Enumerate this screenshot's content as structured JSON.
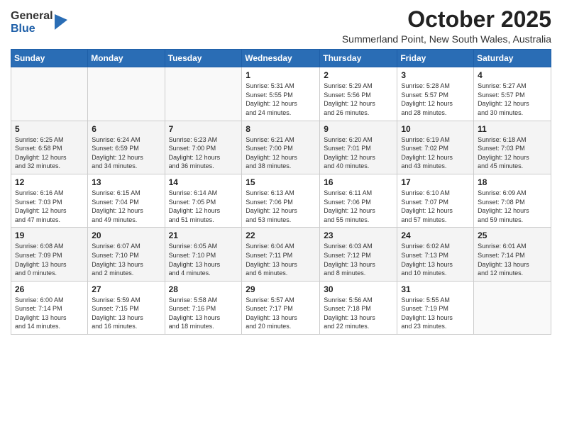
{
  "header": {
    "logo_general": "General",
    "logo_blue": "Blue",
    "month": "October 2025",
    "location": "Summerland Point, New South Wales, Australia"
  },
  "weekdays": [
    "Sunday",
    "Monday",
    "Tuesday",
    "Wednesday",
    "Thursday",
    "Friday",
    "Saturday"
  ],
  "weeks": [
    [
      {
        "day": "",
        "info": ""
      },
      {
        "day": "",
        "info": ""
      },
      {
        "day": "",
        "info": ""
      },
      {
        "day": "1",
        "info": "Sunrise: 5:31 AM\nSunset: 5:55 PM\nDaylight: 12 hours\nand 24 minutes."
      },
      {
        "day": "2",
        "info": "Sunrise: 5:29 AM\nSunset: 5:56 PM\nDaylight: 12 hours\nand 26 minutes."
      },
      {
        "day": "3",
        "info": "Sunrise: 5:28 AM\nSunset: 5:57 PM\nDaylight: 12 hours\nand 28 minutes."
      },
      {
        "day": "4",
        "info": "Sunrise: 5:27 AM\nSunset: 5:57 PM\nDaylight: 12 hours\nand 30 minutes."
      }
    ],
    [
      {
        "day": "5",
        "info": "Sunrise: 6:25 AM\nSunset: 6:58 PM\nDaylight: 12 hours\nand 32 minutes."
      },
      {
        "day": "6",
        "info": "Sunrise: 6:24 AM\nSunset: 6:59 PM\nDaylight: 12 hours\nand 34 minutes."
      },
      {
        "day": "7",
        "info": "Sunrise: 6:23 AM\nSunset: 7:00 PM\nDaylight: 12 hours\nand 36 minutes."
      },
      {
        "day": "8",
        "info": "Sunrise: 6:21 AM\nSunset: 7:00 PM\nDaylight: 12 hours\nand 38 minutes."
      },
      {
        "day": "9",
        "info": "Sunrise: 6:20 AM\nSunset: 7:01 PM\nDaylight: 12 hours\nand 40 minutes."
      },
      {
        "day": "10",
        "info": "Sunrise: 6:19 AM\nSunset: 7:02 PM\nDaylight: 12 hours\nand 43 minutes."
      },
      {
        "day": "11",
        "info": "Sunrise: 6:18 AM\nSunset: 7:03 PM\nDaylight: 12 hours\nand 45 minutes."
      }
    ],
    [
      {
        "day": "12",
        "info": "Sunrise: 6:16 AM\nSunset: 7:03 PM\nDaylight: 12 hours\nand 47 minutes."
      },
      {
        "day": "13",
        "info": "Sunrise: 6:15 AM\nSunset: 7:04 PM\nDaylight: 12 hours\nand 49 minutes."
      },
      {
        "day": "14",
        "info": "Sunrise: 6:14 AM\nSunset: 7:05 PM\nDaylight: 12 hours\nand 51 minutes."
      },
      {
        "day": "15",
        "info": "Sunrise: 6:13 AM\nSunset: 7:06 PM\nDaylight: 12 hours\nand 53 minutes."
      },
      {
        "day": "16",
        "info": "Sunrise: 6:11 AM\nSunset: 7:06 PM\nDaylight: 12 hours\nand 55 minutes."
      },
      {
        "day": "17",
        "info": "Sunrise: 6:10 AM\nSunset: 7:07 PM\nDaylight: 12 hours\nand 57 minutes."
      },
      {
        "day": "18",
        "info": "Sunrise: 6:09 AM\nSunset: 7:08 PM\nDaylight: 12 hours\nand 59 minutes."
      }
    ],
    [
      {
        "day": "19",
        "info": "Sunrise: 6:08 AM\nSunset: 7:09 PM\nDaylight: 13 hours\nand 0 minutes."
      },
      {
        "day": "20",
        "info": "Sunrise: 6:07 AM\nSunset: 7:10 PM\nDaylight: 13 hours\nand 2 minutes."
      },
      {
        "day": "21",
        "info": "Sunrise: 6:05 AM\nSunset: 7:10 PM\nDaylight: 13 hours\nand 4 minutes."
      },
      {
        "day": "22",
        "info": "Sunrise: 6:04 AM\nSunset: 7:11 PM\nDaylight: 13 hours\nand 6 minutes."
      },
      {
        "day": "23",
        "info": "Sunrise: 6:03 AM\nSunset: 7:12 PM\nDaylight: 13 hours\nand 8 minutes."
      },
      {
        "day": "24",
        "info": "Sunrise: 6:02 AM\nSunset: 7:13 PM\nDaylight: 13 hours\nand 10 minutes."
      },
      {
        "day": "25",
        "info": "Sunrise: 6:01 AM\nSunset: 7:14 PM\nDaylight: 13 hours\nand 12 minutes."
      }
    ],
    [
      {
        "day": "26",
        "info": "Sunrise: 6:00 AM\nSunset: 7:14 PM\nDaylight: 13 hours\nand 14 minutes."
      },
      {
        "day": "27",
        "info": "Sunrise: 5:59 AM\nSunset: 7:15 PM\nDaylight: 13 hours\nand 16 minutes."
      },
      {
        "day": "28",
        "info": "Sunrise: 5:58 AM\nSunset: 7:16 PM\nDaylight: 13 hours\nand 18 minutes."
      },
      {
        "day": "29",
        "info": "Sunrise: 5:57 AM\nSunset: 7:17 PM\nDaylight: 13 hours\nand 20 minutes."
      },
      {
        "day": "30",
        "info": "Sunrise: 5:56 AM\nSunset: 7:18 PM\nDaylight: 13 hours\nand 22 minutes."
      },
      {
        "day": "31",
        "info": "Sunrise: 5:55 AM\nSunset: 7:19 PM\nDaylight: 13 hours\nand 23 minutes."
      },
      {
        "day": "",
        "info": ""
      }
    ]
  ]
}
